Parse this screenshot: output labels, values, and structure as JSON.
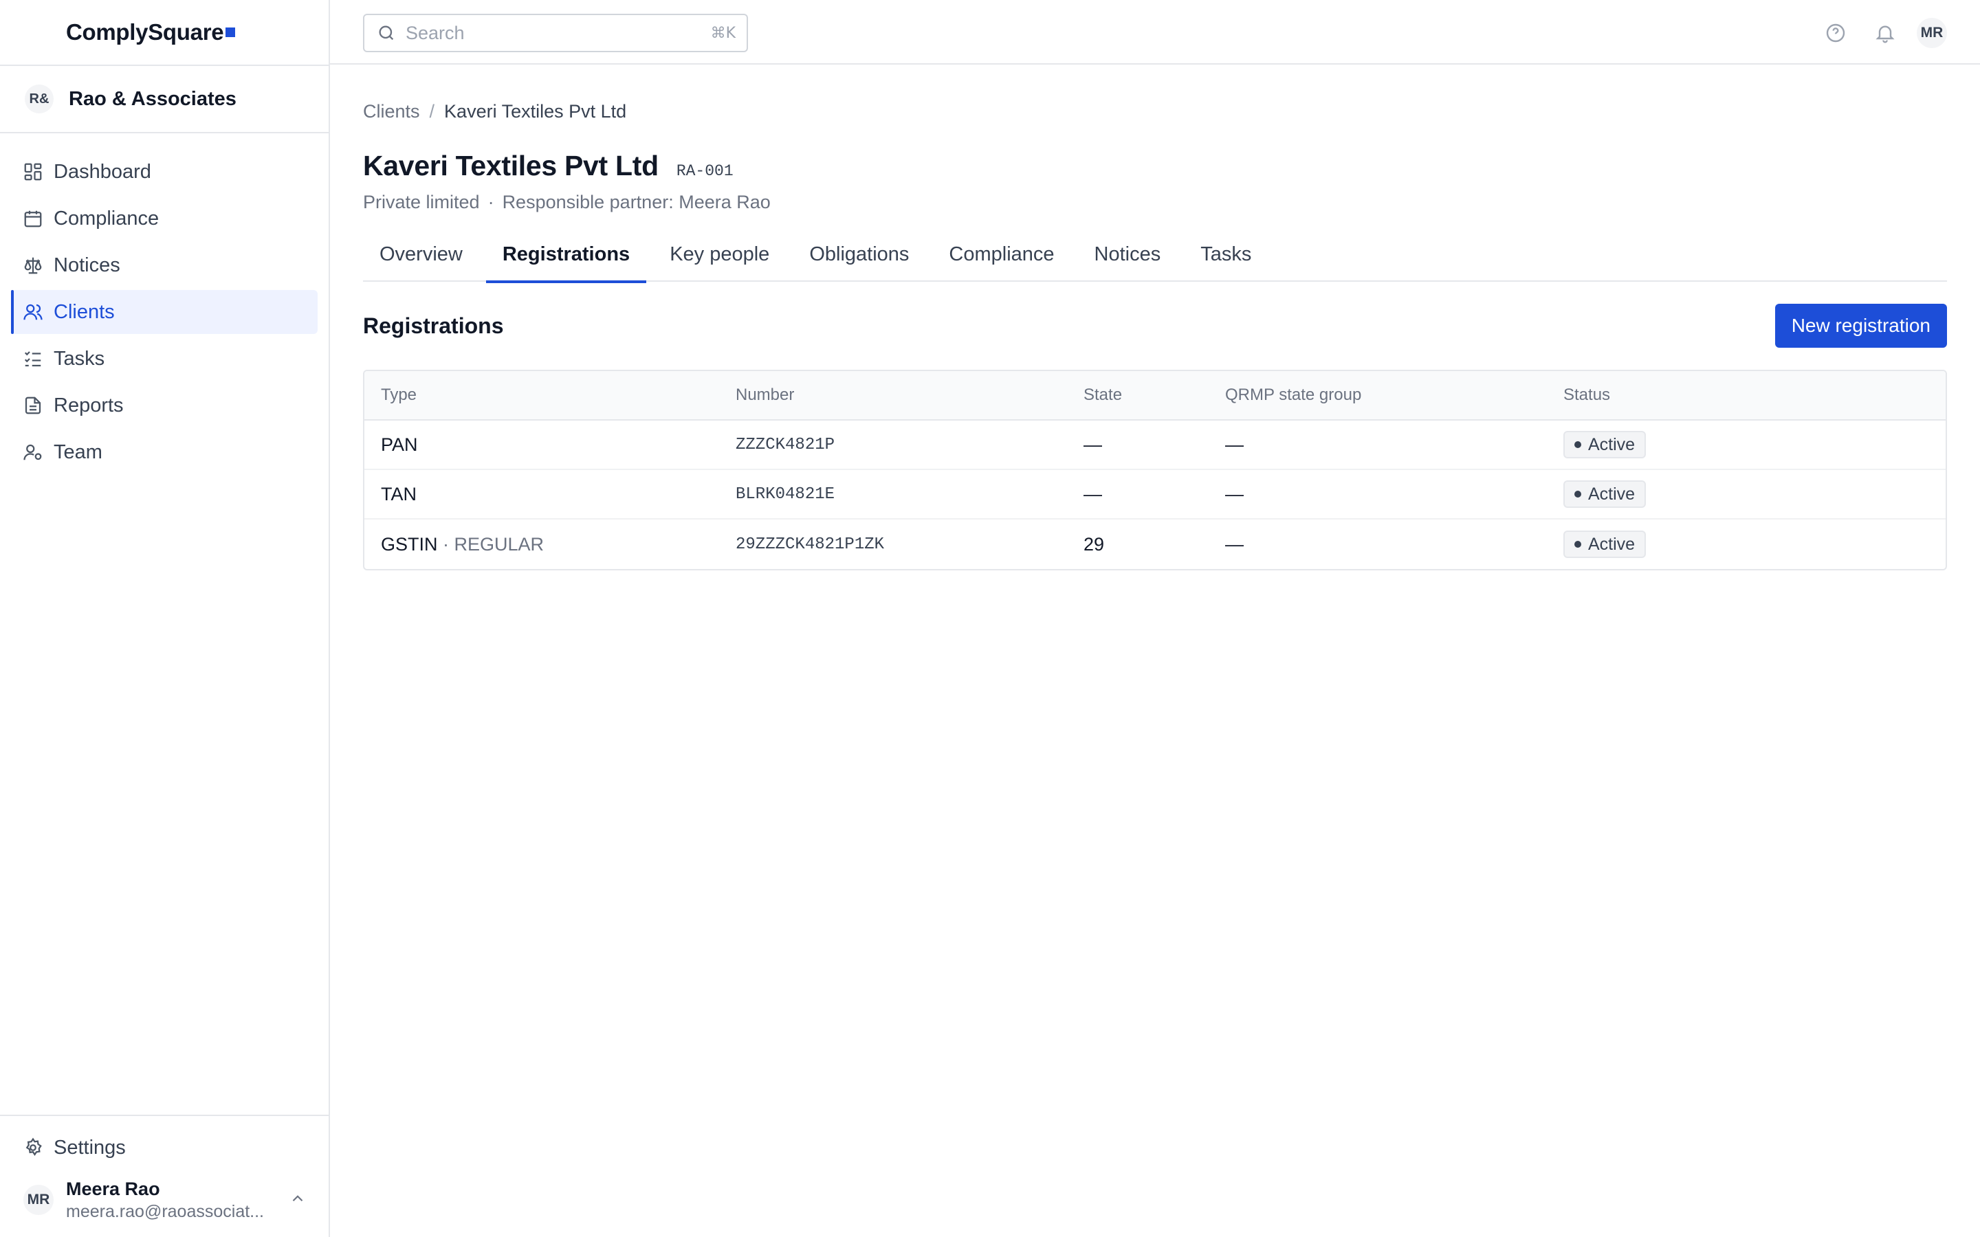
{
  "brand": {
    "name": "ComplySquare"
  },
  "org": {
    "initials": "R&",
    "name": "Rao & Associates"
  },
  "sidebar": {
    "items": [
      {
        "label": "Dashboard",
        "icon": "dashboard-icon"
      },
      {
        "label": "Compliance",
        "icon": "calendar-icon"
      },
      {
        "label": "Notices",
        "icon": "scale-icon"
      },
      {
        "label": "Clients",
        "icon": "users-icon",
        "active": true
      },
      {
        "label": "Tasks",
        "icon": "checklist-icon"
      },
      {
        "label": "Reports",
        "icon": "document-icon"
      },
      {
        "label": "Team",
        "icon": "user-cog-icon"
      }
    ],
    "settings_label": "Settings"
  },
  "user": {
    "initials": "MR",
    "name": "Meera Rao",
    "email": "meera.rao@raoassociat..."
  },
  "topbar": {
    "search_placeholder": "Search",
    "search_shortcut": "⌘K",
    "avatar_initials": "MR"
  },
  "breadcrumb": {
    "parent": "Clients",
    "separator": "/",
    "current": "Kaveri Textiles Pvt Ltd"
  },
  "client": {
    "name": "Kaveri Textiles Pvt Ltd",
    "code": "RA-001",
    "entity_type": "Private limited",
    "separator": "·",
    "partner": "Responsible partner: Meera Rao"
  },
  "tabs": [
    {
      "label": "Overview"
    },
    {
      "label": "Registrations",
      "active": true
    },
    {
      "label": "Key people"
    },
    {
      "label": "Obligations"
    },
    {
      "label": "Compliance"
    },
    {
      "label": "Notices"
    },
    {
      "label": "Tasks"
    }
  ],
  "section": {
    "title": "Registrations",
    "action_label": "New registration"
  },
  "table": {
    "columns": [
      "Type",
      "Number",
      "State",
      "QRMP state group",
      "Status"
    ],
    "rows": [
      {
        "type": "PAN",
        "type_sub": "",
        "number": "ZZZCK4821P",
        "state": "—",
        "qrmp": "—",
        "status": "Active"
      },
      {
        "type": "TAN",
        "type_sub": "",
        "number": "BLRK04821E",
        "state": "—",
        "qrmp": "—",
        "status": "Active"
      },
      {
        "type": "GSTIN",
        "type_sub": "· REGULAR",
        "number": "29ZZZCK4821P1ZK",
        "state": "29",
        "qrmp": "—",
        "status": "Active"
      }
    ]
  },
  "colors": {
    "accent": "#1d4ed8",
    "border": "#e5e7eb",
    "muted_text": "#6b7280"
  }
}
